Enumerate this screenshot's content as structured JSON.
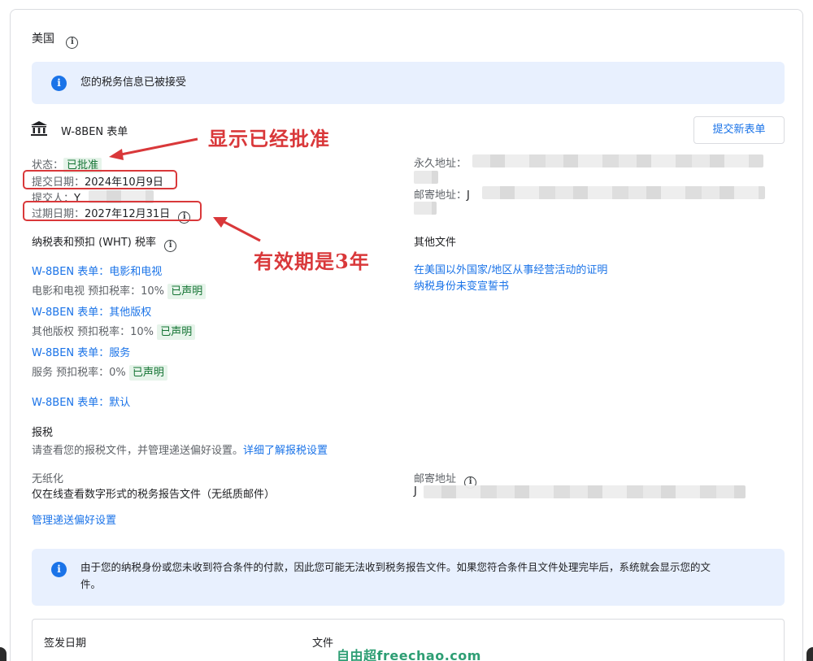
{
  "header": {
    "country": "美国"
  },
  "accepted_banner": {
    "text": "您的税务信息已被接受"
  },
  "form": {
    "name": "W-8BEN 表单",
    "submit_new_label": "提交新表单",
    "status_label": "状态：",
    "status_value": "已批准",
    "submit_date_label": "提交日期：",
    "submit_date_value": "2024年10月9日",
    "submitter_label": "提交人：",
    "submitter_value": "Y",
    "expiry_label": "过期日期：",
    "expiry_value": "2027年12月31日",
    "permanent_address_label": "永久地址：",
    "mailing_address_label": "邮寄地址：",
    "mailing_address_value": "J"
  },
  "wht": {
    "title": "纳税表和预扣 (WHT) 税率",
    "items": [
      {
        "link": "W-8BEN 表单：电影和电视",
        "rate_label": "电影和电视 预扣税率：",
        "rate": "10%",
        "badge": "已声明"
      },
      {
        "link": "W-8BEN 表单：其他版权",
        "rate_label": "其他版权 预扣税率：",
        "rate": "10%",
        "badge": "已声明"
      },
      {
        "link": "W-8BEN 表单：服务",
        "rate_label": "服务 预扣税率：",
        "rate": "0%",
        "badge": "已声明"
      }
    ],
    "default_link": "W-8BEN 表单：默认"
  },
  "other_docs": {
    "title": "其他文件",
    "links": [
      "在美国以外国家/地区从事经营活动的证明",
      "纳税身份未变宣誓书"
    ]
  },
  "tax_report": {
    "title": "报税",
    "desc": "请查看您的报税文件，并管理递送偏好设置。",
    "learn_more": "详细了解报税设置",
    "paperless_title": "无纸化",
    "paperless_desc": "仅在线查看数字形式的税务报告文件（无纸质邮件）",
    "mailing_label": "邮寄地址",
    "mailing_value": "J",
    "manage_link": "管理递送偏好设置"
  },
  "notice_banner": {
    "line1": "由于您的纳税身份或您未收到符合条件的付款，因此您可能无法收到税务报告文件。如果您符合条件且文件处理完毕后，系统就会显示您的文",
    "line2": "件。"
  },
  "table": {
    "col_date": "签发日期",
    "col_file": "文件"
  },
  "annotations": {
    "approved_note": "显示已经批准",
    "validity_note": "有效期是3年"
  },
  "watermark": "自由超freechao.com",
  "icons": {
    "info": "info-icon",
    "bank": "bank-icon",
    "arrow": "arrow-icon"
  },
  "colors": {
    "link": "#1a73e8",
    "annotation": "#d9383a",
    "banner": "#e8f0fe",
    "chip": "#e6f4ea"
  }
}
